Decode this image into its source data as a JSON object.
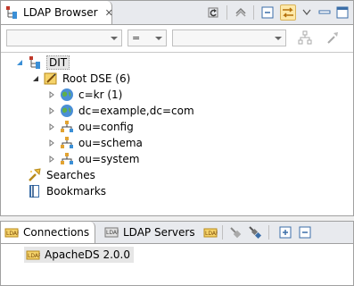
{
  "browser_view": {
    "title": "LDAP Browser",
    "filter": {
      "attribute_value": "",
      "operator_value": "=",
      "value_value": ""
    },
    "tree": [
      {
        "label": "DIT",
        "level": 0,
        "expanded": true,
        "selected": true
      },
      {
        "label": "Root DSE (6)",
        "level": 1,
        "expanded": true
      },
      {
        "label": "c=kr (1)",
        "level": 2,
        "expanded": false
      },
      {
        "label": "dc=example,dc=com",
        "level": 2,
        "expanded": false
      },
      {
        "label": "ou=config",
        "level": 2,
        "expanded": false
      },
      {
        "label": "ou=schema",
        "level": 2,
        "expanded": false
      },
      {
        "label": "ou=system",
        "level": 2,
        "expanded": false
      },
      {
        "label": "Searches",
        "level": 0
      },
      {
        "label": "Bookmarks",
        "level": 0
      }
    ]
  },
  "bottom_view": {
    "tabs": [
      {
        "label": "Connections"
      },
      {
        "label": "LDAP Servers"
      }
    ],
    "connection": "ApacheDS 2.0.0"
  },
  "colors": {
    "accent": "#3b8fd6",
    "selection": "#e6e6e6",
    "folder": "#e2a331"
  }
}
